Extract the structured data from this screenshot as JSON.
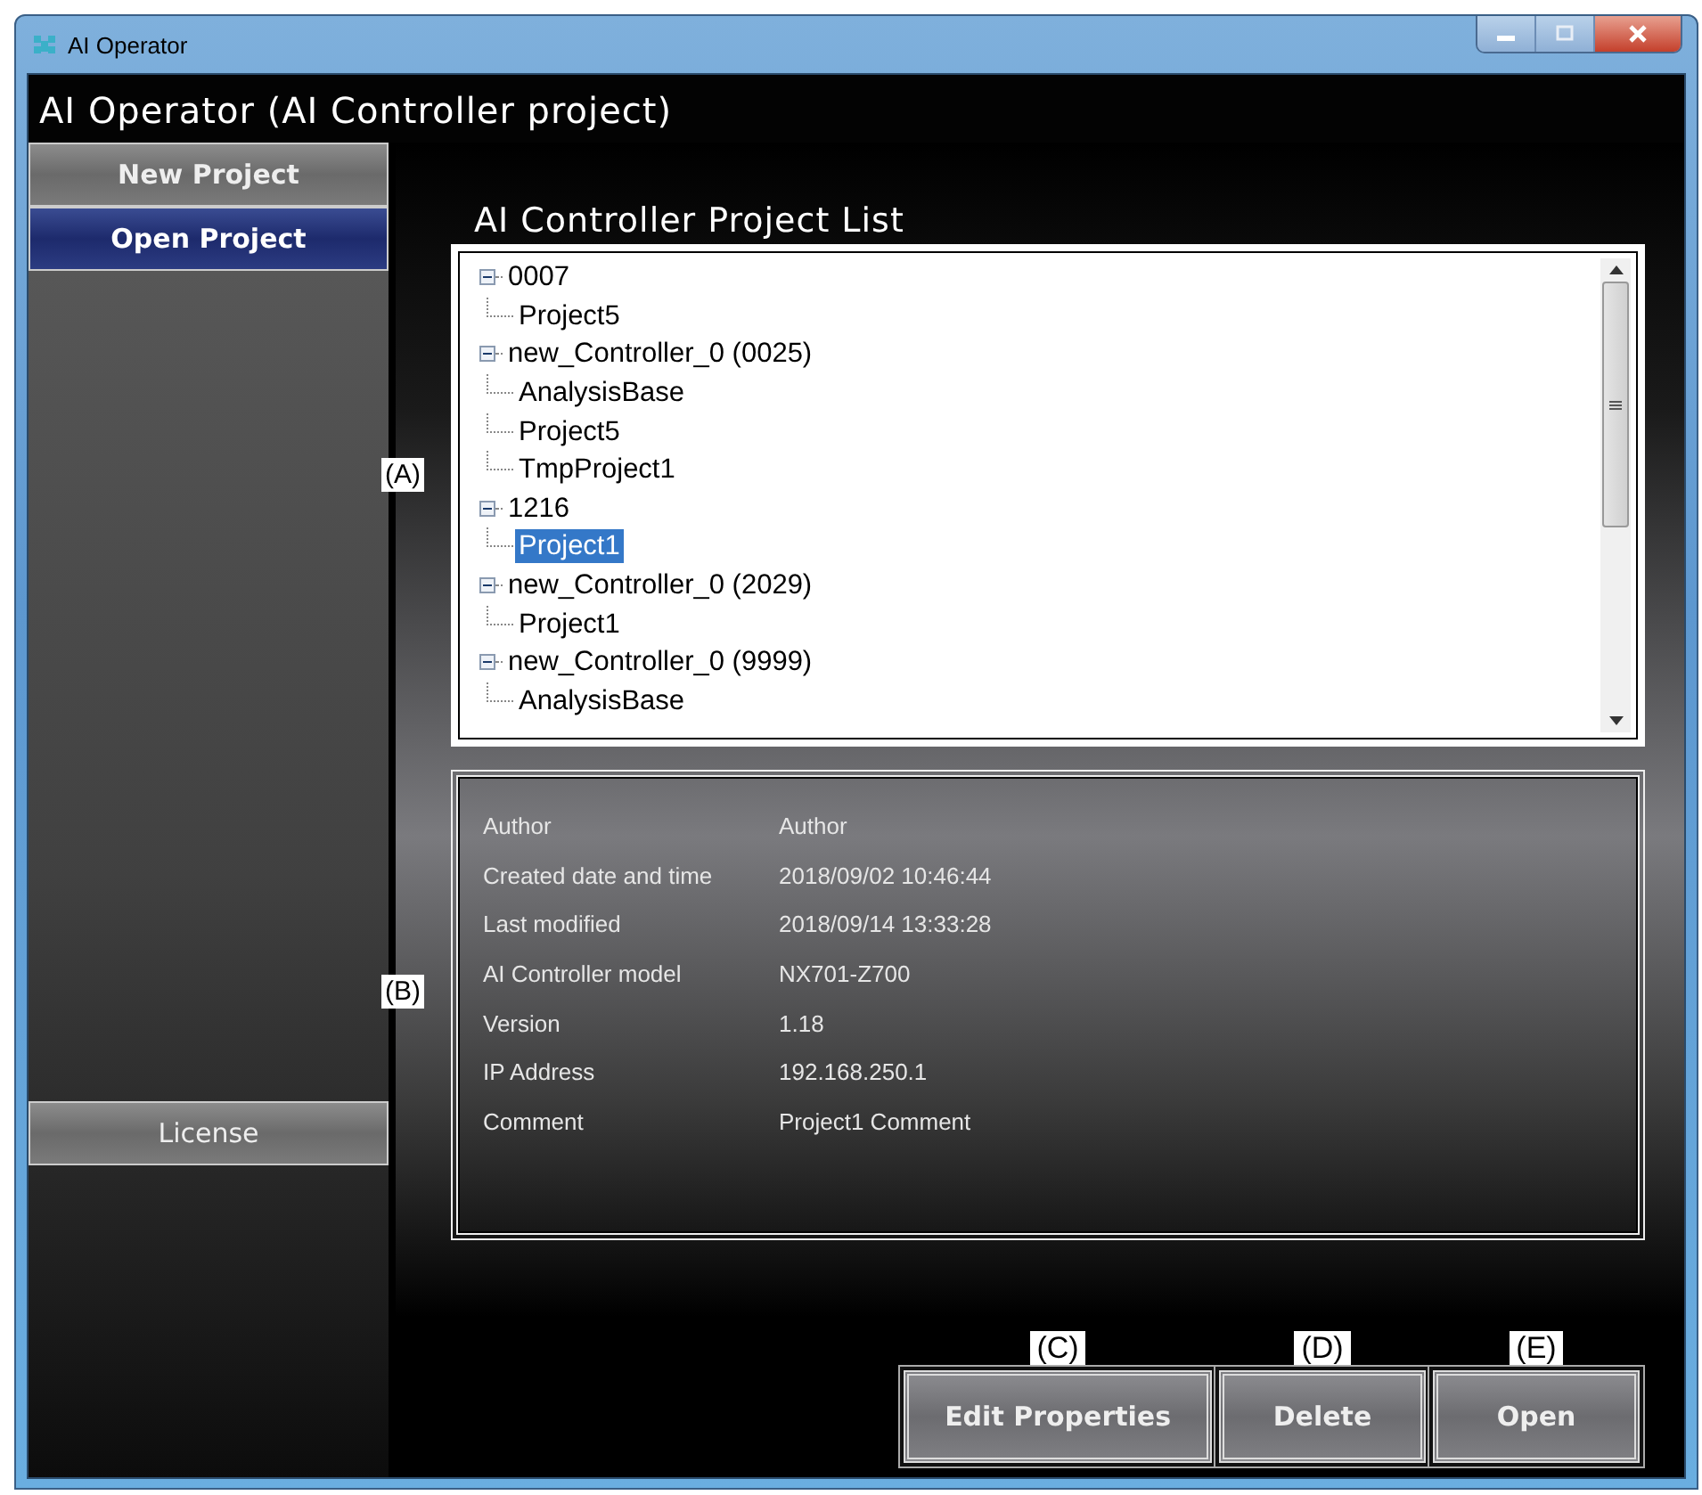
{
  "window": {
    "title": "AI Operator"
  },
  "header": "AI Operator (AI Controller project)",
  "sidebar": {
    "items": [
      {
        "label": "New Project",
        "selected": false
      },
      {
        "label": "Open Project",
        "selected": true
      }
    ],
    "license_button": "License"
  },
  "project_list": {
    "title": "AI Controller Project List",
    "callout": "(A)",
    "nodes": [
      {
        "label": "0007",
        "expanded": true,
        "selected": false,
        "children": [
          {
            "label": "Project5",
            "selected": false
          }
        ]
      },
      {
        "label": "new_Controller_0 (0025)",
        "expanded": true,
        "selected": false,
        "children": [
          {
            "label": "AnalysisBase",
            "selected": false
          },
          {
            "label": "Project5",
            "selected": false
          },
          {
            "label": "TmpProject1",
            "selected": false
          }
        ]
      },
      {
        "label": "1216",
        "expanded": true,
        "selected": false,
        "children": [
          {
            "label": "Project1",
            "selected": true
          }
        ]
      },
      {
        "label": "new_Controller_0 (2029)",
        "expanded": true,
        "selected": false,
        "children": [
          {
            "label": "Project1",
            "selected": false
          }
        ]
      },
      {
        "label": "new_Controller_0 (9999)",
        "expanded": true,
        "selected": false,
        "children": [
          {
            "label": "AnalysisBase",
            "selected": false
          }
        ]
      }
    ]
  },
  "details": {
    "callout": "(B)",
    "rows": [
      {
        "label": "Author",
        "value": "Author"
      },
      {
        "label": "Created date and time",
        "value": "2018/09/02 10:46:44"
      },
      {
        "label": "Last modified",
        "value": "2018/09/14 13:33:28"
      },
      {
        "label": "AI Controller model",
        "value": "NX701-Z700"
      },
      {
        "label": "Version",
        "value": "1.18"
      },
      {
        "label": "IP Address",
        "value": "192.168.250.1"
      },
      {
        "label": "Comment",
        "value": "Project1 Comment"
      }
    ]
  },
  "buttons": [
    {
      "label": "Edit Properties",
      "callout": "(C)"
    },
    {
      "label": "Delete",
      "callout": "(D)"
    },
    {
      "label": "Open",
      "callout": "(E)"
    }
  ]
}
